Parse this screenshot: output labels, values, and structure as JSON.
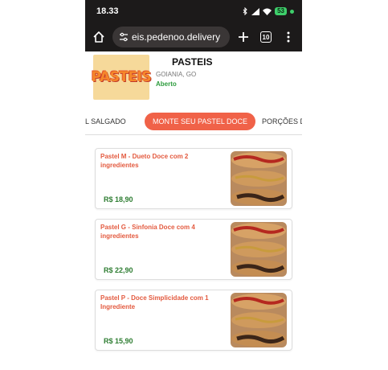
{
  "statusbar": {
    "time": "18.33",
    "battery": "53"
  },
  "browser": {
    "url": "eis.pedenoo.delivery",
    "tab_count": "10"
  },
  "store": {
    "logo_text": "PASTEIS",
    "name": "PASTEIS",
    "city": "GOIANIA, GO",
    "status": "Aberto"
  },
  "tabs": [
    {
      "label": "L SALGADO"
    },
    {
      "label": "MONTE SEU PASTEL DOCE"
    },
    {
      "label": "PORÇÕES D"
    }
  ],
  "products": [
    {
      "name": "Pastel M - Dueto Doce com 2 ingredientes",
      "price": "R$ 18,90"
    },
    {
      "name": "Pastel G - Sinfonia Doce com 4 ingredientes",
      "price": "R$ 22,90"
    },
    {
      "name": "Pastel P - Doce Simplicidade com 1 Ingrediente",
      "price": "R$ 15,90"
    }
  ],
  "colors": {
    "accent": "#f06248",
    "title_red": "#e35a3f",
    "price_green": "#2e7d32",
    "status_green": "#2e9c3e"
  },
  "icons": [
    "home-icon",
    "site-settings-icon",
    "new-tab-icon",
    "tab-switcher-icon",
    "more-menu-icon"
  ]
}
